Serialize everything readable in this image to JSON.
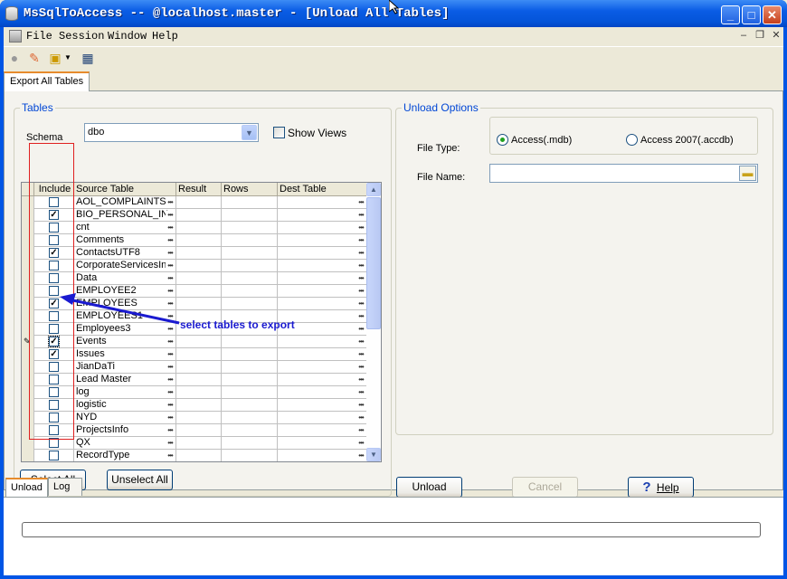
{
  "window": {
    "title": "MsSqlToAccess -- @localhost.master - [Unload All Tables]"
  },
  "menu": [
    "File",
    "Session",
    "Window",
    "Help"
  ],
  "tabs": {
    "main": "Export All Tables",
    "bottom": [
      "Unload",
      "Log"
    ]
  },
  "tables": {
    "legend": "Tables",
    "schema_label": "Schema",
    "schema_value": "dbo",
    "show_views_label": "Show Views",
    "show_views_checked": false,
    "columns": [
      "Include",
      "Source Table",
      "Result",
      "Rows",
      "Dest Table"
    ],
    "rows": [
      {
        "include": false,
        "source": "AOL_COMPLAINTS"
      },
      {
        "include": true,
        "source": "BIO_PERSONAL_IN"
      },
      {
        "include": false,
        "source": "cnt"
      },
      {
        "include": false,
        "source": "Comments"
      },
      {
        "include": true,
        "source": "ContactsUTF8"
      },
      {
        "include": false,
        "source": "CorporateServicesIn"
      },
      {
        "include": false,
        "source": "Data"
      },
      {
        "include": false,
        "source": "EMPLOYEE2"
      },
      {
        "include": true,
        "source": "EMPLOYEES"
      },
      {
        "include": false,
        "source": "EMPLOYEES1"
      },
      {
        "include": false,
        "source": "Employees3"
      },
      {
        "include": true,
        "source": "Events"
      },
      {
        "include": true,
        "source": "Issues"
      },
      {
        "include": false,
        "source": "JianDaTi"
      },
      {
        "include": false,
        "source": "Lead Master"
      },
      {
        "include": false,
        "source": "log"
      },
      {
        "include": false,
        "source": "logistic"
      },
      {
        "include": false,
        "source": "NYD"
      },
      {
        "include": false,
        "source": "ProjectsInfo"
      },
      {
        "include": false,
        "source": "QX"
      },
      {
        "include": false,
        "source": "RecordType"
      }
    ],
    "select_all_label": "Select All",
    "unselect_all_label": "Unselect All"
  },
  "unload_options": {
    "legend": "Unload Options",
    "file_type_label": "File Type:",
    "file_types": [
      "Access(.mdb)",
      "Access 2007(.accdb)"
    ],
    "file_type_selected": 0,
    "file_name_label": "File Name:",
    "file_name_value": ""
  },
  "buttons": {
    "unload": "Unload",
    "cancel": "Cancel",
    "help": "Help"
  },
  "annotation": {
    "text": "select tables to export"
  },
  "icons": {
    "app": "database-icon",
    "help": "help-question-icon",
    "browse": "folder-icon"
  }
}
